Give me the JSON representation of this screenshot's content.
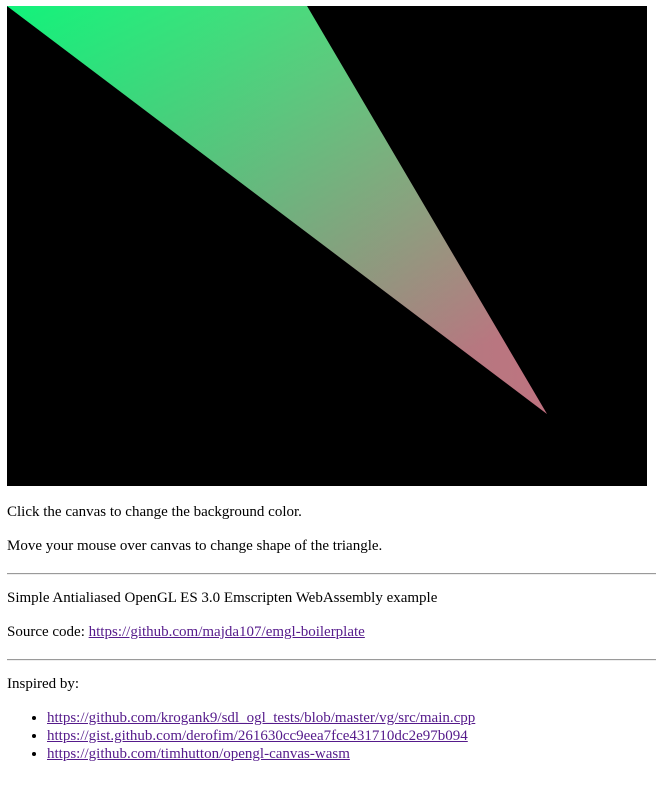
{
  "canvas": {
    "background": "#000000",
    "triangle_colors": {
      "top_left": "#00ff7f",
      "top_right": "#7fff7f",
      "bottom": "#e0207f"
    }
  },
  "instructions": {
    "click_text": "Click the canvas to change the background color.",
    "move_text": "Move your mouse over canvas to change shape of the triangle."
  },
  "about": {
    "description": "Simple Antialiased OpenGL ES 3.0 Emscripten WebAssembly example",
    "source_label": "Source code: ",
    "source_link": "https://github.com/majda107/emgl-boilerplate"
  },
  "inspired": {
    "heading": "Inspired by:",
    "links": [
      "https://github.com/krogank9/sdl_ogl_tests/blob/master/vg/src/main.cpp",
      "https://gist.github.com/derofim/261630cc9eea7fce431710dc2e97b094",
      "https://github.com/timhutton/opengl-canvas-wasm"
    ]
  }
}
